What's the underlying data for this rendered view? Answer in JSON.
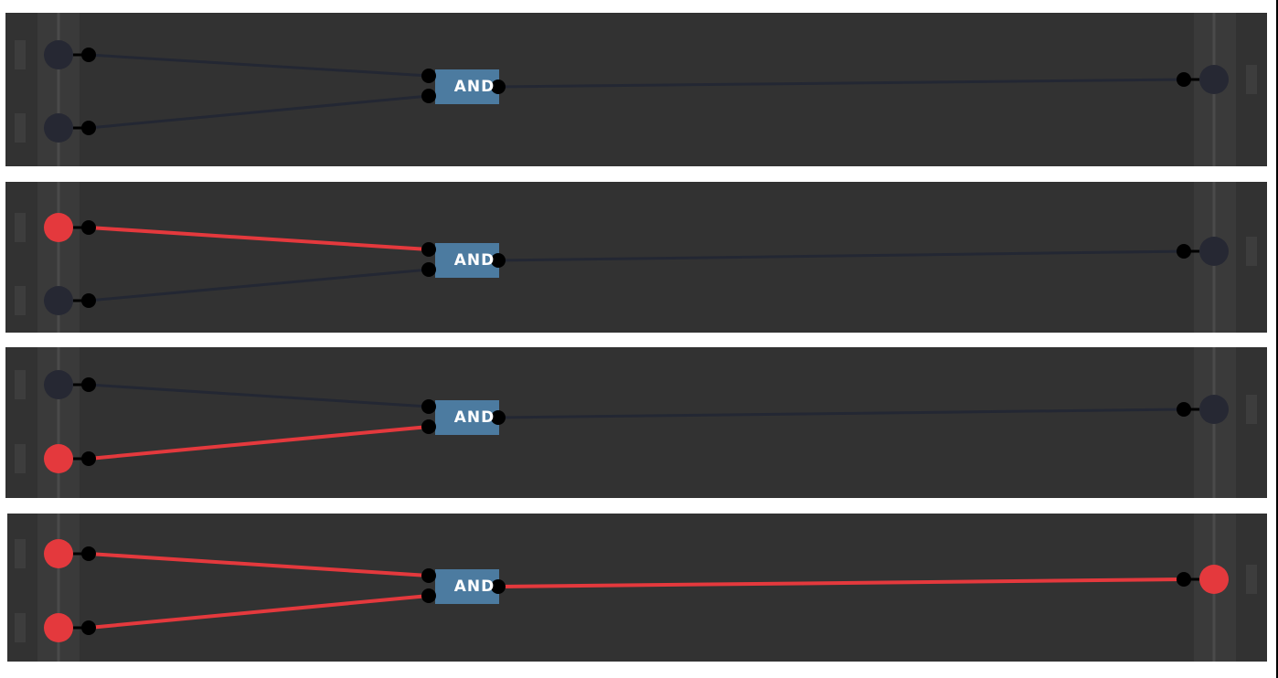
{
  "colors": {
    "background": "#ffffff",
    "panel": "#323232",
    "rail": "#3a3a3a",
    "rail_line": "#4a4a4a",
    "rail_tab": "#3d3d3d",
    "off": "#262833",
    "on": "#e4393d",
    "wire_off": "#232733",
    "wire_on": "#e4393d",
    "pin": "#000000",
    "gate": "#4c7ba0"
  },
  "gate_type": "AND",
  "scenarios": [
    {
      "input_a": false,
      "input_b": false,
      "output": false,
      "label": "AND"
    },
    {
      "input_a": true,
      "input_b": false,
      "output": false,
      "label": "AND"
    },
    {
      "input_a": false,
      "input_b": true,
      "output": false,
      "label": "AND"
    },
    {
      "input_a": true,
      "input_b": true,
      "output": true,
      "label": "AND"
    }
  ]
}
